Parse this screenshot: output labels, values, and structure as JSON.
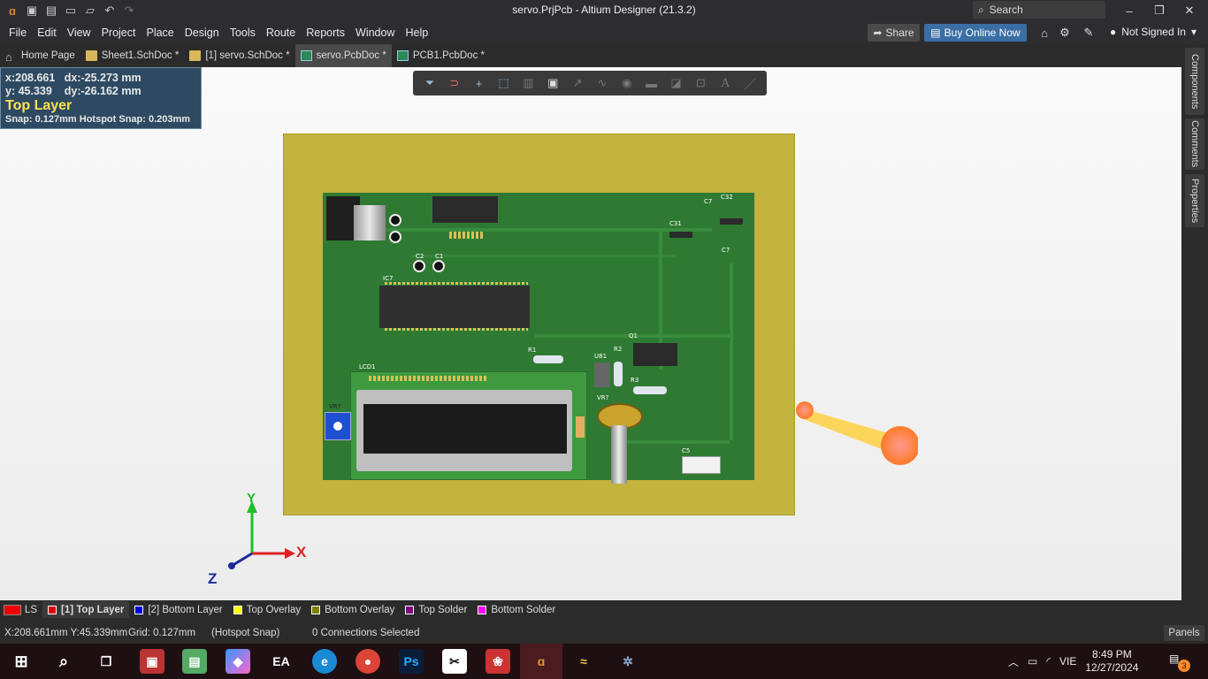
{
  "window": {
    "title": "servo.PrjPcb - Altium Designer (21.3.2)",
    "search_placeholder": "Search"
  },
  "menu": [
    "File",
    "Edit",
    "View",
    "Project",
    "Place",
    "Design",
    "Tools",
    "Route",
    "Reports",
    "Window",
    "Help"
  ],
  "header": {
    "share_label": "Share",
    "buy_label": "Buy Online Now",
    "user_label": "Not Signed In"
  },
  "tabs": [
    {
      "label": "Home Page",
      "icon": "home-icon"
    },
    {
      "label": "Sheet1.SchDoc *",
      "icon": "folder-icon"
    },
    {
      "label": "[1] servo.SchDoc *",
      "icon": "folder-icon"
    },
    {
      "label": "servo.PcbDoc *",
      "icon": "pcb-icon",
      "active": true
    },
    {
      "label": "PCB1.PcbDoc *",
      "icon": "pcb-icon"
    }
  ],
  "side_panels": [
    "Components",
    "Comments",
    "Properties"
  ],
  "hud": {
    "x": "x:208.661",
    "dx": "dx:-25.273 mm",
    "y": "y: 45.339",
    "dy": "dy:-26.162  mm",
    "layer": "Top Layer",
    "snap": "Snap: 0.127mm Hotspot Snap: 0.203mm"
  },
  "pcb_labels": {
    "ic7": "IC7",
    "lcd1": "LCD1",
    "c1": "C1",
    "c2": "C2",
    "c31": "C31",
    "c32": "C32",
    "c7a": "C7",
    "c7b": "C7",
    "q1": "Q1",
    "r1": "R1",
    "r2": "R2",
    "r3": "R3",
    "u81": "U81",
    "vr_a": "VR?",
    "vr_b": "VR?",
    "c5": "C5"
  },
  "axes": {
    "x": "X",
    "y": "Y",
    "z": "Z"
  },
  "layers": {
    "ls": "LS",
    "items": [
      {
        "label": "[1] Top Layer",
        "color": "#e00000",
        "active": true
      },
      {
        "label": "[2] Bottom Layer",
        "color": "#0000e0"
      },
      {
        "label": "Top Overlay",
        "color": "#ffff00"
      },
      {
        "label": "Bottom Overlay",
        "color": "#808000"
      },
      {
        "label": "Top Solder",
        "color": "#800080"
      },
      {
        "label": "Bottom Solder",
        "color": "#ff00ff"
      }
    ]
  },
  "status": {
    "coords": "X:208.661mm Y:45.339mm",
    "grid": "Grid: 0.127mm",
    "snap": "(Hotspot Snap)",
    "connections": "0 Connections Selected",
    "panels": "Panels"
  },
  "taskbar": {
    "lang": "VIE",
    "time": "8:49 PM",
    "date": "12/27/2024",
    "notifications": "3"
  }
}
